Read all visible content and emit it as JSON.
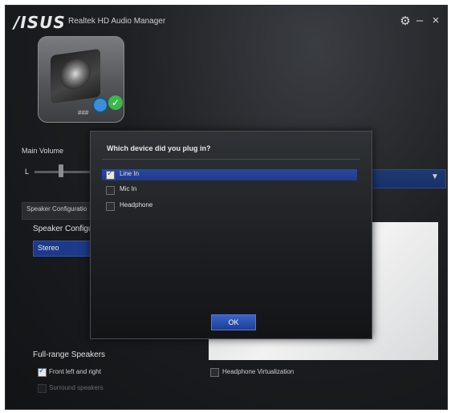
{
  "window": {
    "brand": "/ISUS",
    "title": "Realtek HD Audio Manager",
    "controls": {
      "settings": "⚙",
      "minimize": "–",
      "close": "×"
    }
  },
  "device": {
    "label": "###"
  },
  "main_volume": {
    "label": "Main Volume",
    "left_label": "L"
  },
  "speaker_config": {
    "tab_label": "Speaker Configuratio",
    "heading": "Speaker Configu",
    "selected": "Stereo"
  },
  "full_range": {
    "heading": "Full-range Speakers",
    "options": [
      {
        "label": "Front left and right",
        "checked": true,
        "enabled": true
      },
      {
        "label": "Surround speakers",
        "checked": false,
        "enabled": false
      }
    ],
    "headphone_virtualization": {
      "label": "Headphone Virtualization",
      "checked": false
    }
  },
  "dialog": {
    "title": "Which device did you plug in?",
    "options": [
      {
        "label": "Line In",
        "checked": true
      },
      {
        "label": "Mic In",
        "checked": false
      },
      {
        "label": "Headphone",
        "checked": false
      }
    ],
    "ok_label": "OK"
  },
  "colors": {
    "accent_blue": "#1f3a88",
    "status_green": "#3fb64a",
    "status_blue": "#3a8fd9"
  }
}
